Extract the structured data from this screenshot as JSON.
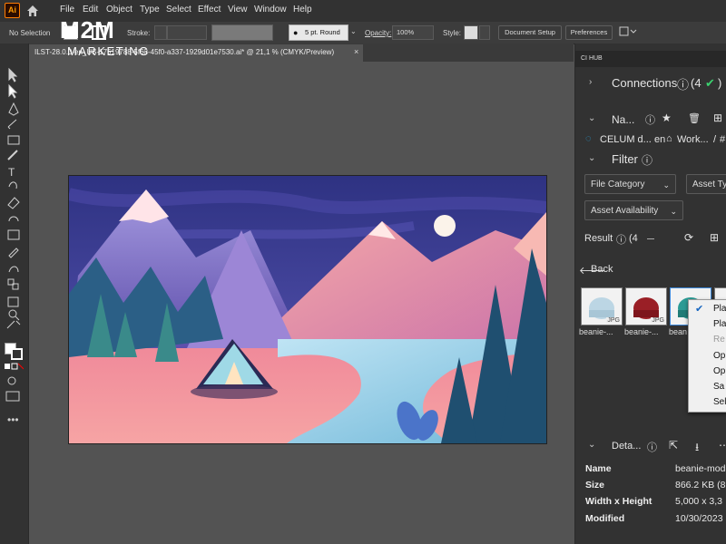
{
  "app": {
    "logo": "Ai"
  },
  "menu": [
    "File",
    "Edit",
    "Object",
    "Type",
    "Select",
    "Effect",
    "View",
    "Window",
    "Help"
  ],
  "watermark": {
    "title": "M2M",
    "subtitle": "MARKETING"
  },
  "control_bar": {
    "selection": "No Selection",
    "stroke_label": "Stroke:",
    "brush": "5 pt. Round",
    "opacity_label": "Opacity:",
    "opacity_value": "100%",
    "style_label": "Style:",
    "document_setup": "Document Setup",
    "preferences": "Preferences"
  },
  "document_tab": {
    "label": "ILST-28.0.0-en_US-17519788-5f63-45f0-a337-1929d01e7530.ai* @ 21,1 % (CMYK/Preview)",
    "close": "×"
  },
  "right_panel": {
    "title": "CI HUB",
    "connections_label": "Connections",
    "connections_count": "(4",
    "name_label": "Na...",
    "path": {
      "source": "CELUM d...",
      "lang": "en",
      "home": "Work...",
      "sep": "/",
      "extra": "#"
    },
    "filter_label": "Filter",
    "filters": [
      "File Category",
      "Asset Ty",
      "Asset Availability"
    ],
    "result_label": "Result",
    "result_count": "(4",
    "back_label": "Back",
    "thumbs": [
      {
        "name": "beanie-...",
        "badge": "JPG",
        "color": "#bcd6e4"
      },
      {
        "name": "beanie-...",
        "badge": "JPG",
        "color": "#9a1f26"
      },
      {
        "name": "bean",
        "badge": "",
        "color": "#2c9b95"
      }
    ],
    "context_menu": [
      "Pla",
      "Pla",
      "Re",
      "Op",
      "Op",
      "Sa",
      "Sel"
    ],
    "details_label": "Deta...",
    "details": [
      {
        "label": "Name",
        "value": "beanie-mod"
      },
      {
        "label": "Size",
        "value": "866.2 KB (8"
      },
      {
        "label": "Width x Height",
        "value": "5,000 x 3,3"
      },
      {
        "label": "Modified",
        "value": "10/30/2023"
      }
    ]
  }
}
